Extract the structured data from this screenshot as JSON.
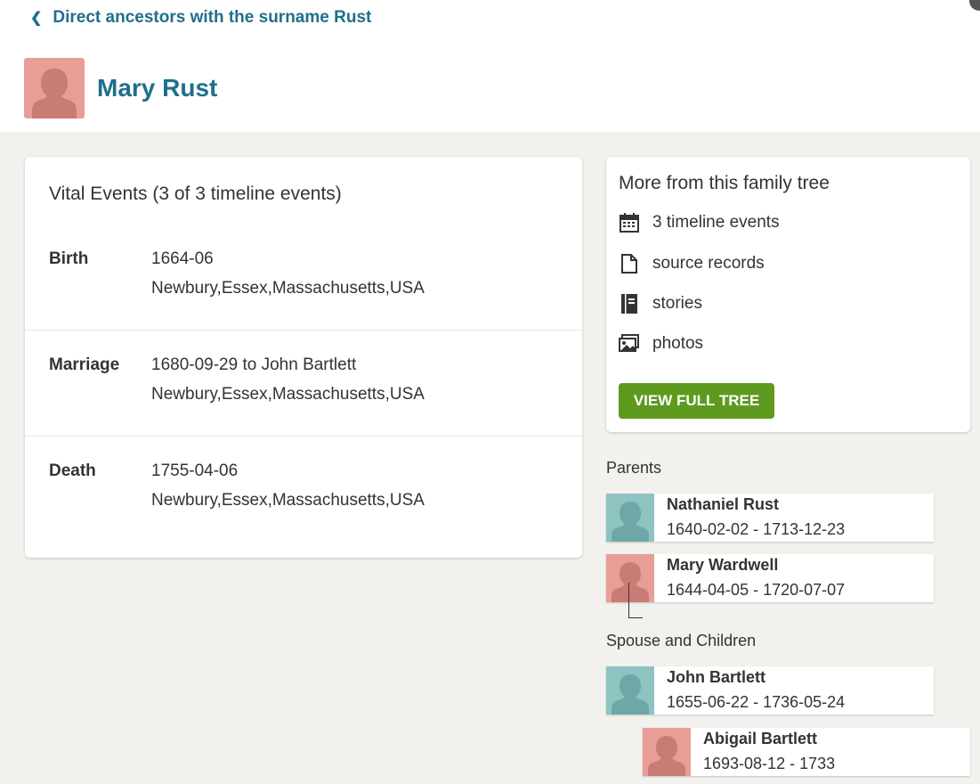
{
  "header": {
    "back_link": "Direct ancestors with the surname Rust",
    "person_name": "Mary Rust"
  },
  "vital_events": {
    "title": "Vital Events (3 of 3 timeline events)",
    "events": [
      {
        "label": "Birth",
        "line1": "1664-06",
        "line2": "Newbury,Essex,Massachusetts,USA"
      },
      {
        "label": "Marriage",
        "line1": "1680-09-29 to John Bartlett",
        "line2": "Newbury,Essex,Massachusetts,USA"
      },
      {
        "label": "Death",
        "line1": "1755-04-06",
        "line2": "Newbury,Essex,Massachusetts,USA"
      }
    ]
  },
  "more": {
    "title": "More from this family tree",
    "items": [
      {
        "icon": "calendar-icon",
        "label": "3 timeline events"
      },
      {
        "icon": "document-icon",
        "label": "source records"
      },
      {
        "icon": "book-icon",
        "label": "stories"
      },
      {
        "icon": "photo-icon",
        "label": "photos"
      }
    ],
    "button": "VIEW FULL TREE"
  },
  "parents": {
    "label": "Parents",
    "people": [
      {
        "name": "Nathaniel Rust",
        "dates": "1640-02-02 - 1713-12-23",
        "gender": "male"
      },
      {
        "name": "Mary Wardwell",
        "dates": "1644-04-05 - 1720-07-07",
        "gender": "female"
      }
    ]
  },
  "spouse": {
    "label": "Spouse and Children",
    "people": [
      {
        "name": "John Bartlett",
        "dates": "1655-06-22 - 1736-05-24",
        "gender": "male"
      },
      {
        "name": "Abigail Bartlett",
        "dates": "1693-08-12 - 1733",
        "gender": "female"
      }
    ]
  },
  "colors": {
    "link": "#1f6f8b",
    "button": "#5e9a1e",
    "female_avatar": "#e89d96",
    "male_avatar": "#8dc3c1",
    "panel_bg": "#f2f1ed"
  }
}
